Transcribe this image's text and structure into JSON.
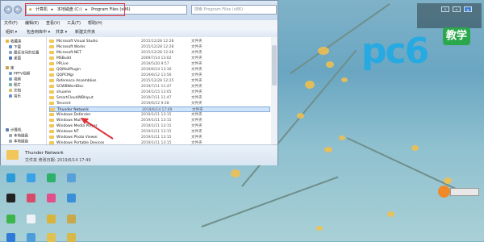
{
  "window": {
    "address": {
      "segments": [
        "计算机",
        "本地磁盘 (C:)",
        "Program Files (x86)"
      ],
      "separator": "▸"
    },
    "search_placeholder": "搜索 Program Files (x86)",
    "menu": [
      "文件(F)",
      "编辑(E)",
      "查看(V)",
      "工具(T)",
      "帮助(H)"
    ],
    "commands": [
      "组织 ▾",
      "包含到库中 ▾",
      "共享 ▾",
      "新建文件夹"
    ],
    "sidebar": [
      {
        "label": "收藏夹",
        "icon": "star-icon"
      },
      {
        "label": "下载",
        "icon": "download-icon"
      },
      {
        "label": "最近访问的位置",
        "icon": "recent-icon"
      },
      {
        "label": "桌面",
        "icon": "desktop-icon"
      },
      {
        "label": "库",
        "icon": "library-icon"
      },
      {
        "label": "PPTV视频",
        "icon": "video-library-icon"
      },
      {
        "label": "视频",
        "icon": "video-icon"
      },
      {
        "label": "图片",
        "icon": "picture-icon"
      },
      {
        "label": "文档",
        "icon": "document-icon"
      },
      {
        "label": "音乐",
        "icon": "music-icon"
      },
      {
        "label": "计算机",
        "icon": "computer-icon"
      },
      {
        "label": "本地磁盘",
        "icon": "drive-icon"
      },
      {
        "label": "本地磁盘",
        "icon": "drive-icon"
      },
      {
        "label": "本地磁盘",
        "icon": "drive-icon"
      }
    ],
    "files": [
      {
        "name": "Microsoft Visual Studio",
        "date": "2015/12/28 12:28",
        "type": "文件夹"
      },
      {
        "name": "Microsoft Works",
        "date": "2015/12/28 12:28",
        "type": "文件夹"
      },
      {
        "name": "Microsoft.NET",
        "date": "2015/12/28 12:26",
        "type": "文件夹"
      },
      {
        "name": "MSBuild",
        "date": "2009/7/14 13:02",
        "type": "文件夹"
      },
      {
        "name": "PPLive",
        "date": "2019/5/20 9:57",
        "type": "文件夹"
      },
      {
        "name": "QQMailPlugin",
        "date": "2019/6/14 13:30",
        "type": "文件夹"
      },
      {
        "name": "QQPCMgr",
        "date": "2019/6/12 13:56",
        "type": "文件夹"
      },
      {
        "name": "Reference Assemblies",
        "date": "2015/12/28 12:25",
        "type": "文件夹"
      },
      {
        "name": "SCWBWordDoc",
        "date": "2019/7/11 11:47",
        "type": "文件夹"
      },
      {
        "name": "shuame",
        "date": "2019/1/15 13:05",
        "type": "文件夹"
      },
      {
        "name": "SmartCloudWBInput",
        "date": "2019/7/11 11:47",
        "type": "文件夹"
      },
      {
        "name": "Tencent",
        "date": "2019/6/12 9:28",
        "type": "文件夹"
      },
      {
        "name": "Thunder Network",
        "date": "2019/6/14 17:49",
        "type": "文件夹"
      },
      {
        "name": "Windows Defender",
        "date": "2019/1/11 13:15",
        "type": "文件夹"
      },
      {
        "name": "Windows Mail",
        "date": "2019/1/11 13:15",
        "type": "文件夹"
      },
      {
        "name": "Windows Media Player",
        "date": "2019/1/11 13:15",
        "type": "文件夹"
      },
      {
        "name": "Windows NT",
        "date": "2019/1/11 13:15",
        "type": "文件夹"
      },
      {
        "name": "Windows Photo Viewer",
        "date": "2019/1/11 13:15",
        "type": "文件夹"
      },
      {
        "name": "Windows Portable Devices",
        "date": "2019/1/11 13:15",
        "type": "文件夹"
      }
    ],
    "selected_index": 12,
    "details": {
      "name": "Thunder Network",
      "info": "文件夹  修改日期: 2019/6/14 17:49"
    }
  },
  "logo": {
    "letters": "pc6",
    "badge": "教学"
  },
  "colors": {
    "logo_blue": "#27a9e1",
    "badge_green": "#2aa84a",
    "highlight_red": "#e0303a"
  }
}
